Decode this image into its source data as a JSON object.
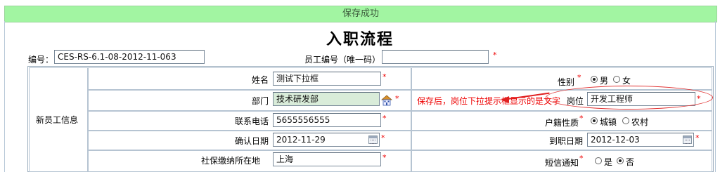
{
  "banner": {
    "message": "保存成功"
  },
  "title": "入职流程",
  "header": {
    "code_label": "编号：",
    "code_value": "CES-RS-6.1-08-2012-11-063",
    "emp_no_label": "员工编号（唯一码）",
    "emp_no_value": "",
    "required_mark": "*"
  },
  "section_label": "新员工信息",
  "form": {
    "name_label": "姓名",
    "name_value": "测试下拉框",
    "dept_label": "部门",
    "dept_value": "技术研发部",
    "phone_label": "联系电话",
    "phone_value": "5655556555",
    "confirm_date_label": "确认日期",
    "confirm_date_value": "2012-11-29",
    "social_label": "社保缴纳所在地",
    "social_value": "上海",
    "gender_label": "性别",
    "gender_options": [
      "男",
      "女"
    ],
    "gender_selected": "男",
    "position_label": "岗位",
    "position_value": "开发工程师",
    "hukou_label": "户籍性质",
    "hukou_options": [
      "城镇",
      "农村"
    ],
    "hukou_selected": "城镇",
    "arrival_date_label": "到职日期",
    "arrival_date_value": "2012-12-03",
    "sms_label": "短信通知",
    "sms_options": [
      "是",
      "否"
    ],
    "sms_selected": "否"
  },
  "annotation": "保存后，岗位下拉提示框显示的是文字",
  "colors": {
    "banner_bg": "#a2f5a2",
    "annotation": "#e00000",
    "dept_bg": "#d9ecd9"
  },
  "icons": [
    "dept-picker-icon",
    "calendar-icon"
  ]
}
